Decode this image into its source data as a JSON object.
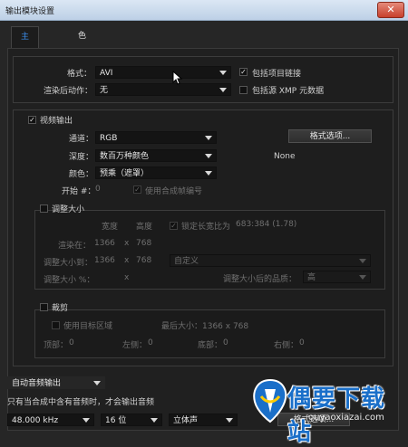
{
  "window": {
    "title": "输出模块设置",
    "close_glyph": "✕"
  },
  "tabs": [
    {
      "label": "主要选项",
      "active": true
    },
    {
      "label": "色彩管理",
      "active": false
    }
  ],
  "main": {
    "format_label": "格式：",
    "format_value": "AVI",
    "include_project_link_label": "包括项目链接",
    "include_project_link_checked": true,
    "post_render_label": "渲染后动作：",
    "post_render_value": "无",
    "include_xmp_label": "包括源 XMP 元数据",
    "include_xmp_checked": false
  },
  "video": {
    "section_label": "视频输出",
    "checked": true,
    "channels_label": "通道：",
    "channels_value": "RGB",
    "depth_label": "深度：",
    "depth_value": "数百万种颜色",
    "color_label": "颜色：",
    "color_value": "预乘（遮罩）",
    "start_label": "开始 #：",
    "start_value": "0",
    "use_comp_frame_label": "使用合成帧编号",
    "format_options_button": "格式选项...",
    "codec_value": "None"
  },
  "resize": {
    "section_label": "调整大小",
    "width_header": "宽度",
    "height_header": "高度",
    "lock_aspect_label": "锁定长宽比为",
    "lock_aspect_value": "683:384 (1.78)",
    "render_at_label": "渲染在：",
    "render_at_w": "1366",
    "render_at_x": "x",
    "render_at_h": "768",
    "resize_to_label": "调整大小到：",
    "resize_to_w": "1366",
    "resize_to_x": "x",
    "resize_to_h": "768",
    "preset_value": "自定义",
    "resize_pct_label": "调整大小 %：",
    "resize_pct_x": "x",
    "quality_label": "调整大小后的品质：",
    "quality_value": "高"
  },
  "crop": {
    "section_label": "裁剪",
    "use_roi_label": "使用目标区域",
    "max_size_label": "最后大小：1366 x 768",
    "top_label": "顶部：",
    "top_value": "0",
    "left_label": "左侧：",
    "left_value": "0",
    "bottom_label": "底部：",
    "bottom_value": "0",
    "right_label": "右侧：",
    "right_value": "0"
  },
  "audio": {
    "auto_audio_value": "自动音频输出",
    "note": "只有当合成中含有音频时，才会输出音频",
    "sample_rate_value": "48.000 kHz",
    "bit_depth_value": "16 位",
    "channels_value": "立体声",
    "format_options_button": "格式选项..."
  },
  "watermark": {
    "name": "偶要下载站",
    "url": "ouyaoxiazai.com"
  },
  "colors": {
    "accent": "#3b8ff0",
    "background": "#262626",
    "watermark": "#1a6fc9"
  }
}
